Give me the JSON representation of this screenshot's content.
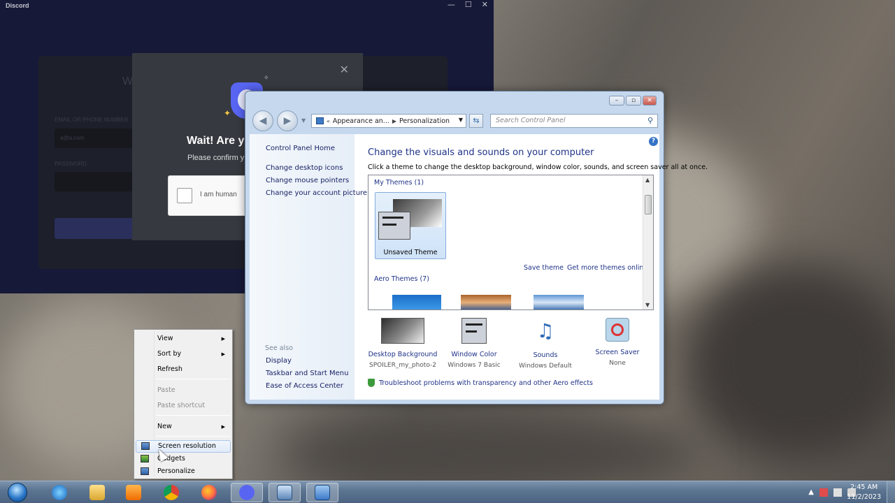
{
  "discord": {
    "title": "Discord",
    "captcha_title": "Wait! Are y",
    "captcha_subtitle": "Please confirm y",
    "captcha_checkbox_label": "I am human",
    "faint_welcome": "W",
    "faint_email_label": "EMAIL OR PHONE NUMBER",
    "faint_email_value": "a@a.com",
    "faint_password_label": "PASSWORD"
  },
  "personalization": {
    "address_part1": "Appearance an...",
    "address_part2": "Personalization",
    "search_placeholder": "Search Control Panel",
    "sidebar": {
      "home": "Control Panel Home",
      "links": [
        "Change desktop icons",
        "Change mouse pointers",
        "Change your account picture"
      ],
      "see_also_label": "See also",
      "see_also": [
        "Display",
        "Taskbar and Start Menu",
        "Ease of Access Center"
      ]
    },
    "heading": "Change the visuals and sounds on your computer",
    "description": "Click a theme to change the desktop background, window color, sounds, and screen saver all at once.",
    "my_themes_label": "My Themes (1)",
    "selected_theme": "Unsaved Theme",
    "save_theme": "Save theme",
    "get_more_themes": "Get more themes online",
    "aero_themes_label": "Aero Themes (7)",
    "bottom": [
      {
        "title": "Desktop Background",
        "sub": "SPOILER_my_photo-2"
      },
      {
        "title": "Window Color",
        "sub": "Windows 7 Basic"
      },
      {
        "title": "Sounds",
        "sub": "Windows Default"
      },
      {
        "title": "Screen Saver",
        "sub": "None"
      }
    ],
    "troubleshoot": "Troubleshoot problems with transparency and other Aero effects"
  },
  "context_menu": {
    "view": "View",
    "sort_by": "Sort by",
    "refresh": "Refresh",
    "paste": "Paste",
    "paste_shortcut": "Paste shortcut",
    "new": "New",
    "screen_resolution": "Screen resolution",
    "gadgets": "Gadgets",
    "personalize": "Personalize"
  },
  "taskbar": {
    "time": "2:45 AM",
    "date": "11/2/2023"
  },
  "colors": {
    "discord_bg": "#161938",
    "discord_blurple": "#5865f2",
    "cp_link": "#1e3287",
    "taskbar": "#5c7591"
  },
  "icons": {
    "start": "windows-start-orb",
    "ie": "internet-explorer-icon",
    "explorer": "folder-icon",
    "media": "media-player-icon",
    "chrome": "chrome-icon",
    "firefox": "firefox-icon",
    "discord": "discord-icon",
    "window_switch": "window-icon",
    "control_panel": "control-panel-icon"
  }
}
